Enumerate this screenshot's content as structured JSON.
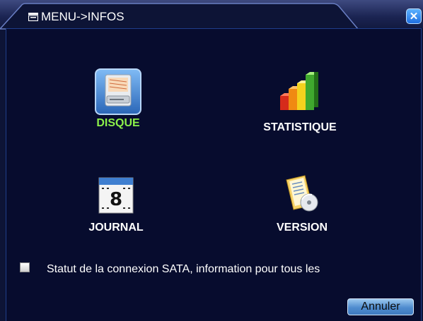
{
  "window": {
    "title": "MENU->INFOS",
    "close_symbol": "✕"
  },
  "menu": {
    "items": [
      {
        "label": "DISQUE",
        "icon": "disk-icon",
        "selected": true
      },
      {
        "label": "STATISTIQUE",
        "icon": "bar-chart-icon",
        "selected": false
      },
      {
        "label": "JOURNAL",
        "icon": "calendar-icon",
        "selected": false
      },
      {
        "label": "VERSION",
        "icon": "version-document-icon",
        "selected": false
      }
    ]
  },
  "calendar_day": "8",
  "sata_info": {
    "text": "Statut de la connexion SATA, information pour tous les"
  },
  "buttons": {
    "cancel_label": "Annuler"
  },
  "colors": {
    "selected_label": "#8cf04a",
    "background": "#070c2e",
    "accent": "#2b67b8"
  }
}
